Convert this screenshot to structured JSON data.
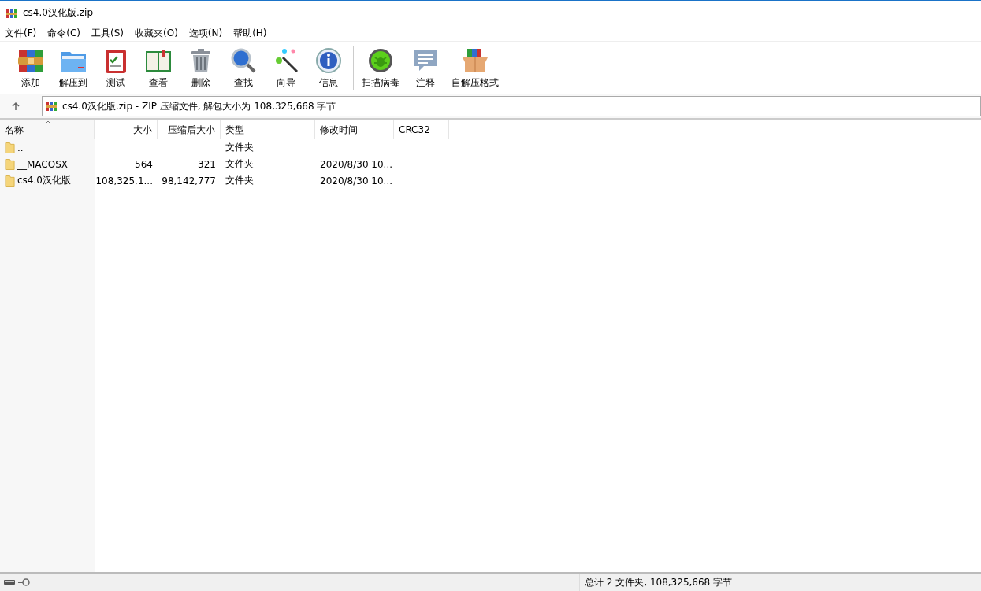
{
  "window": {
    "title": "cs4.0汉化版.zip"
  },
  "menu": [
    "文件(F)",
    "命令(C)",
    "工具(S)",
    "收藏夹(O)",
    "选项(N)",
    "帮助(H)"
  ],
  "toolbar": {
    "groups": [
      [
        {
          "label": "添加"
        },
        {
          "label": "解压到"
        },
        {
          "label": "测试"
        },
        {
          "label": "查看"
        },
        {
          "label": "删除"
        },
        {
          "label": "查找"
        },
        {
          "label": "向导"
        },
        {
          "label": "信息"
        }
      ],
      [
        {
          "label": "扫描病毒"
        },
        {
          "label": "注释"
        },
        {
          "label": "自解压格式"
        }
      ]
    ]
  },
  "address": {
    "text": "cs4.0汉化版.zip - ZIP 压缩文件, 解包大小为 108,325,668 字节"
  },
  "table": {
    "columns": [
      {
        "label": "名称",
        "sorted": true
      },
      {
        "label": "大小",
        "sorted": false
      },
      {
        "label": "压缩后大小",
        "sorted": false
      },
      {
        "label": "类型",
        "sorted": false
      },
      {
        "label": "修改时间",
        "sorted": false
      },
      {
        "label": "CRC32",
        "sorted": false
      }
    ],
    "rows": [
      {
        "cells": [
          "..",
          "",
          "",
          "文件夹",
          "",
          ""
        ]
      },
      {
        "cells": [
          "__MACOSX",
          "564",
          "321",
          "文件夹",
          "2020/8/30 10...",
          ""
        ]
      },
      {
        "cells": [
          "cs4.0汉化版",
          "108,325,1...",
          "98,142,777",
          "文件夹",
          "2020/8/30 10...",
          ""
        ]
      }
    ]
  },
  "status_bar": {
    "text": "总计 2 文件夹, 108,325,668 字节"
  }
}
